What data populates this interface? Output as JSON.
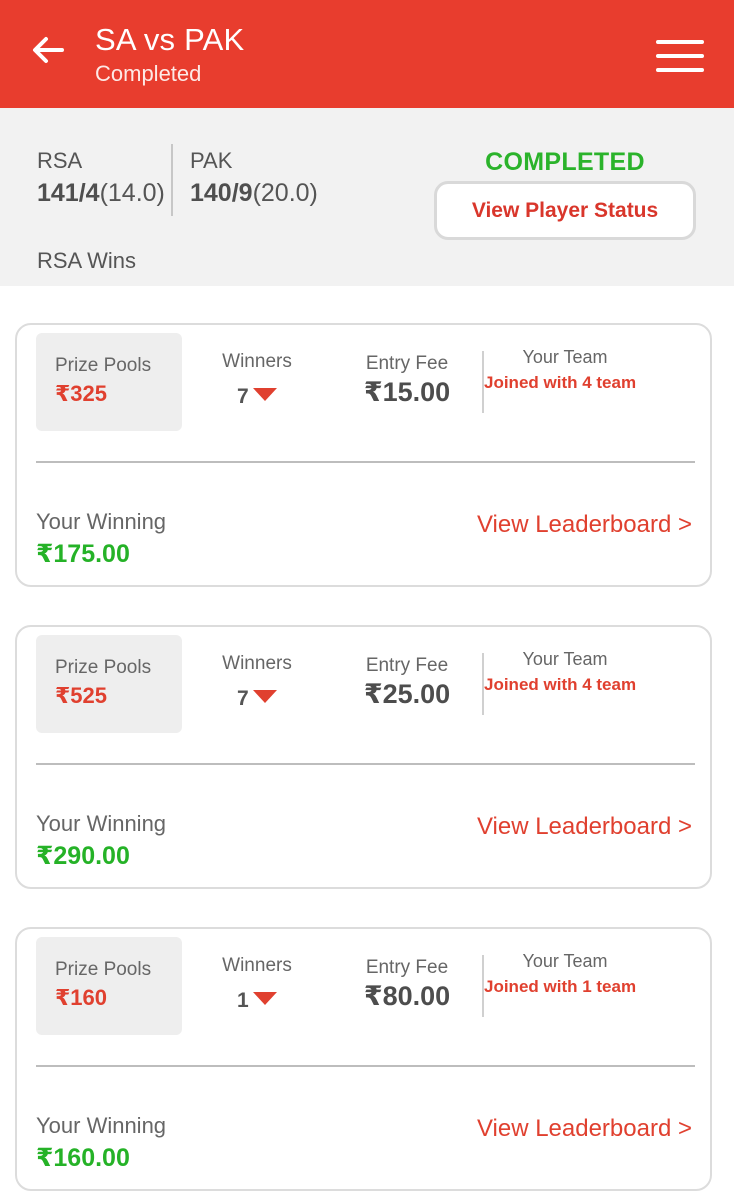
{
  "header": {
    "title": "SA vs PAK",
    "subtitle": "Completed",
    "back_icon": "arrow-left-icon",
    "menu_icon": "hamburger-menu-icon",
    "bg_color": "#e83d2e"
  },
  "match": {
    "team1": {
      "name": "RSA",
      "score": "141/4",
      "overs": "(14.0)"
    },
    "team2": {
      "name": "PAK",
      "score": "140/9",
      "overs": "(20.0)"
    },
    "status": "COMPLETED",
    "status_color": "#2bb32b",
    "player_status_button": "View Player Status",
    "result": "RSA Wins"
  },
  "contests": [
    {
      "prize_pool_label": "Prize Pools",
      "prize_pool": "₹325",
      "winners_label": "Winners",
      "winners": "7",
      "entry_fee_label": "Entry Fee",
      "entry_fee": "₹15.00",
      "your_team_label": "Your Team",
      "your_team": "Joined with 4 team",
      "winning_label": "Your Winning",
      "winning": "₹175.00",
      "leaderboard_link": "View Leaderboard >"
    },
    {
      "prize_pool_label": "Prize Pools",
      "prize_pool": "₹525",
      "winners_label": "Winners",
      "winners": "7",
      "entry_fee_label": "Entry Fee",
      "entry_fee": "₹25.00",
      "your_team_label": "Your Team",
      "your_team": "Joined with 4 team",
      "winning_label": "Your Winning",
      "winning": "₹290.00",
      "leaderboard_link": "View Leaderboard >"
    },
    {
      "prize_pool_label": "Prize Pools",
      "prize_pool": "₹160",
      "winners_label": "Winners",
      "winners": "1",
      "entry_fee_label": "Entry Fee",
      "entry_fee": "₹80.00",
      "your_team_label": "Your Team",
      "your_team": "Joined with 1 team",
      "winning_label": "Your Winning",
      "winning": "₹160.00",
      "leaderboard_link": "View Leaderboard >"
    }
  ],
  "colors": {
    "accent": "#e0402f",
    "winning": "#25b227"
  }
}
